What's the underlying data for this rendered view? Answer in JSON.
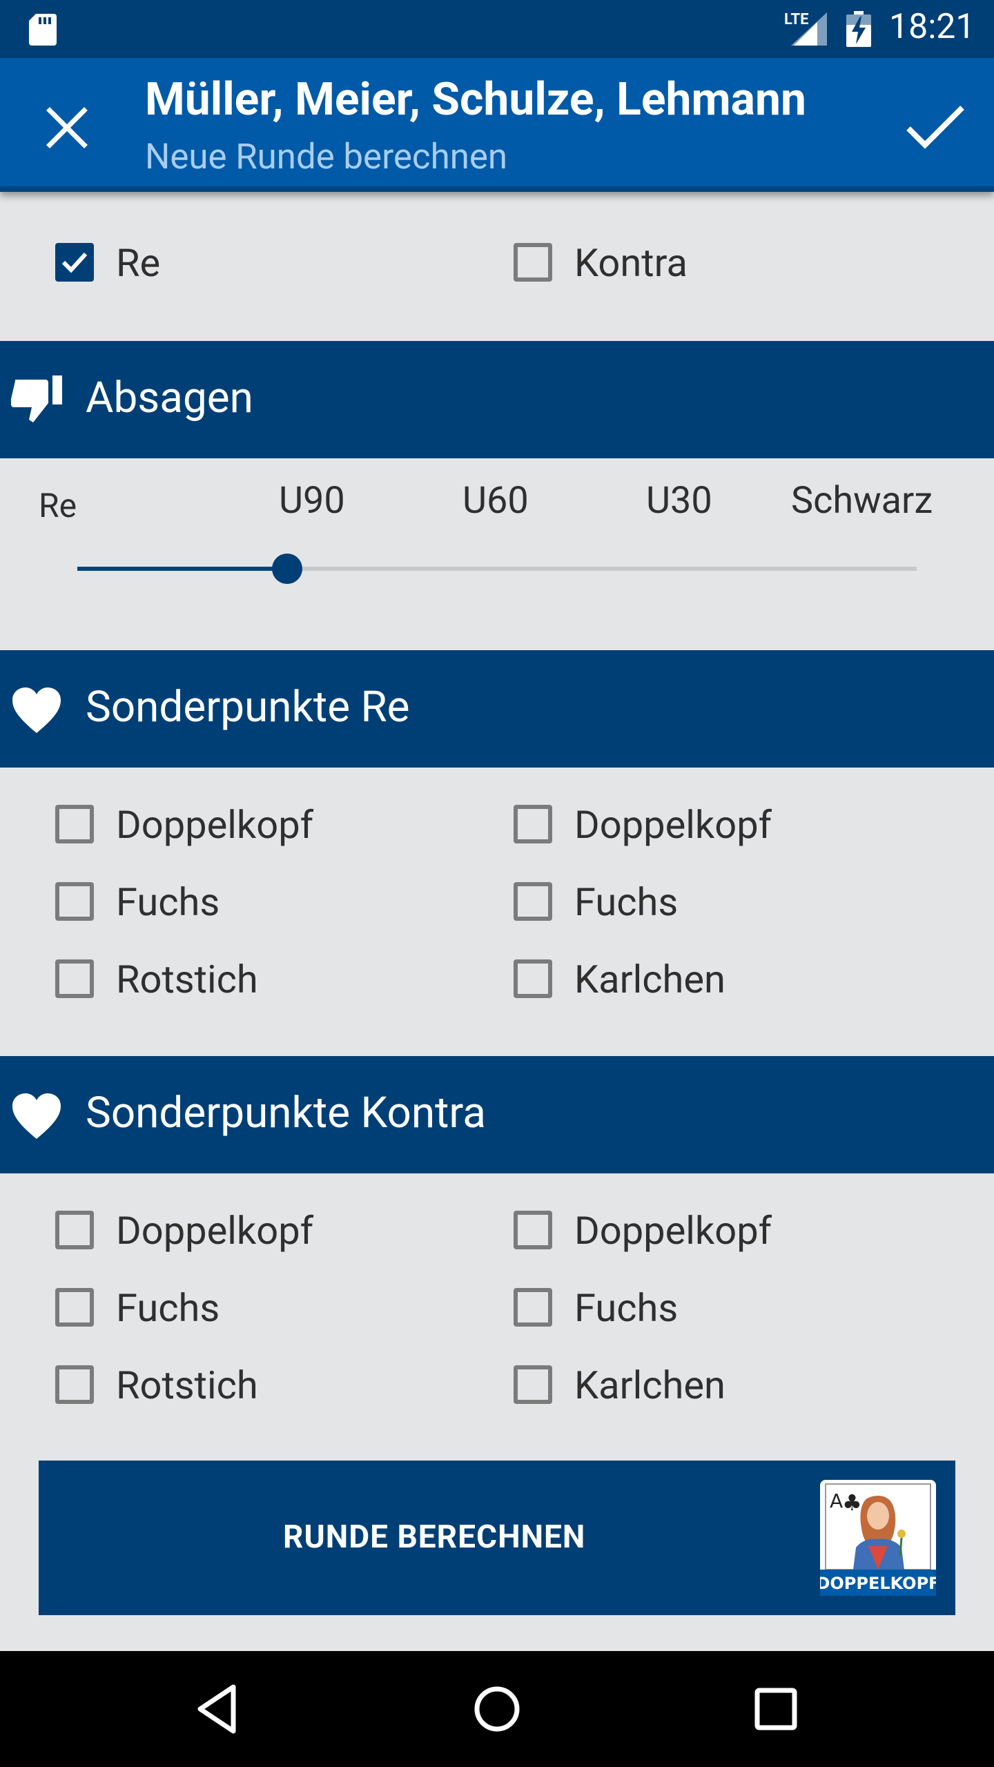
{
  "status_bar": {
    "network": "LTE",
    "time": "18:21",
    "icons": [
      "sd-card-icon",
      "signal-icon",
      "battery-charging-icon"
    ]
  },
  "app_bar": {
    "title": "Müller, Meier, Schulze, Lehmann",
    "subtitle": "Neue Runde berechnen",
    "close_icon": "close-icon",
    "confirm_icon": "check-icon"
  },
  "team_choice": {
    "options": [
      {
        "label": "Re",
        "checked": true
      },
      {
        "label": "Kontra",
        "checked": false
      }
    ]
  },
  "absagen": {
    "title": "Absagen",
    "icon": "thumbs-down-icon",
    "labels": [
      "Re",
      "U90",
      "U60",
      "U30",
      "Schwarz"
    ],
    "selected": "U90",
    "selected_index": 1
  },
  "sonderpunkte_re": {
    "title": "Sonderpunkte Re",
    "icon": "heart-icon",
    "left": [
      {
        "label": "Doppelkopf",
        "checked": false
      },
      {
        "label": "Fuchs",
        "checked": false
      },
      {
        "label": "Rotstich",
        "checked": false
      }
    ],
    "right": [
      {
        "label": "Doppelkopf",
        "checked": false
      },
      {
        "label": "Fuchs",
        "checked": false
      },
      {
        "label": "Karlchen",
        "checked": false
      }
    ]
  },
  "sonderpunkte_kontra": {
    "title": "Sonderpunkte Kontra",
    "icon": "heart-icon",
    "left": [
      {
        "label": "Doppelkopf",
        "checked": false
      },
      {
        "label": "Fuchs",
        "checked": false
      },
      {
        "label": "Rotstich",
        "checked": false
      }
    ],
    "right": [
      {
        "label": "Doppelkopf",
        "checked": false
      },
      {
        "label": "Fuchs",
        "checked": false
      },
      {
        "label": "Karlchen",
        "checked": false
      }
    ]
  },
  "action": {
    "label": "RUNDE BERECHNEN",
    "logo_text": "DOPPELKOPF"
  },
  "colors": {
    "primary_dark": "#003f75",
    "app_bar": "#005aa7",
    "background": "#e4e5e7",
    "subtitle": "#a9cdf0"
  },
  "nav_bar": [
    "back-icon",
    "home-icon",
    "recents-icon"
  ]
}
